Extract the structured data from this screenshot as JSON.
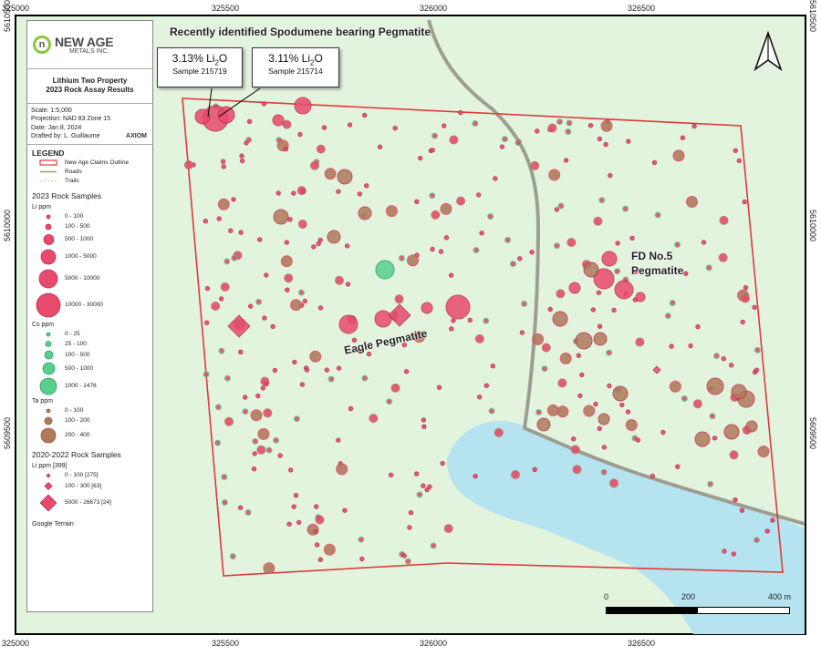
{
  "coords": {
    "top": [
      "325000",
      "325500",
      "326000",
      "326500"
    ],
    "bottom": [
      "325000",
      "325500",
      "326000",
      "326500"
    ],
    "left": [
      "5610500",
      "5610000",
      "5609500"
    ],
    "right": [
      "5610500",
      "5610000",
      "5609500"
    ]
  },
  "logo": {
    "main": "NEW AGE",
    "sub": "METALS INC."
  },
  "title": {
    "line1": "Lithium Two Property",
    "line2": "2023 Rock Assay Results"
  },
  "meta": {
    "scale": "Scale: 1:5,000",
    "projection": "Projection: NAD 83 Zone 15",
    "date": "Date: Jan 8, 2024",
    "drafted": "Drafted by: L. Guillaume",
    "axiom": "AXIOM"
  },
  "legend": {
    "heading": "LEGEND",
    "claims": "New Age Claims Outline",
    "roads": "Roads",
    "trails": "Trails",
    "section_2023": "2023 Rock Samples",
    "li_unit": "Li ppm",
    "li_classes": [
      "0 - 100",
      "100 - 500",
      "500 - 1000",
      "1000 - 5000",
      "5000 - 10000",
      "10000 - 30000"
    ],
    "cs_unit": "Cs ppm",
    "cs_classes": [
      "0 - 25",
      "25 - 100",
      "100 - 500",
      "500 - 1000",
      "1000 - 1476"
    ],
    "ta_unit": "Ta ppm",
    "ta_classes": [
      "0 - 100",
      "100 - 200",
      "200 - 400"
    ],
    "section_old": "2020-2022 Rock Samples",
    "old_unit": "Li ppm [399]",
    "old_classes": [
      "0 - 100 [275]",
      "100 - 300 [63]",
      "5000 - 26673 [24]"
    ],
    "basemap": "Google Terrain"
  },
  "headline": "Recently identified Spodumene bearing Pegmatite",
  "callouts": [
    {
      "value": "3.13% Li",
      "sub": "Sample 215719"
    },
    {
      "value": "3.11% Li",
      "sub": "Sample 215714"
    }
  ],
  "oxide_suffix": "O",
  "labels": {
    "fd_line1": "FD No.5",
    "fd_line2": "Pegmatite",
    "eagle": "Eagle Pegmatite"
  },
  "scale": {
    "l0": "0",
    "l1": "200",
    "l2": "400 m"
  },
  "colors": {
    "land": "#ddf1dc",
    "water": "#b7e3ef",
    "claims": "#e03a3a",
    "road": "#a89a6a",
    "li": "#e84a6c",
    "cs": "#59cf8e",
    "ta": "#b07a5a"
  }
}
